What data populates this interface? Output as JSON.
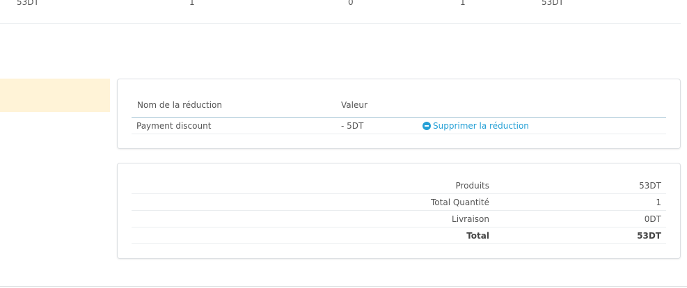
{
  "product_row": {
    "unit_price": "53DT",
    "quantity": "1",
    "refunded": "0",
    "stock": "1",
    "total": "53DT"
  },
  "discounts": {
    "header": {
      "name": "Nom de la réduction",
      "value": "Valeur"
    },
    "rows": [
      {
        "name": "Payment discount",
        "value": "- 5DT",
        "action": "Supprimer la réduction",
        "action_icon": "minus-circle-icon"
      }
    ],
    "accent_color": "#25a0d6"
  },
  "totals": {
    "rows": [
      {
        "label": "Produits",
        "value": "53DT"
      },
      {
        "label": "Total Quantité",
        "value": "1"
      },
      {
        "label": "Livraison",
        "value": "0DT"
      },
      {
        "label": "Total",
        "value": "53DT"
      }
    ]
  },
  "alert": {
    "color": "#fff3d7"
  }
}
